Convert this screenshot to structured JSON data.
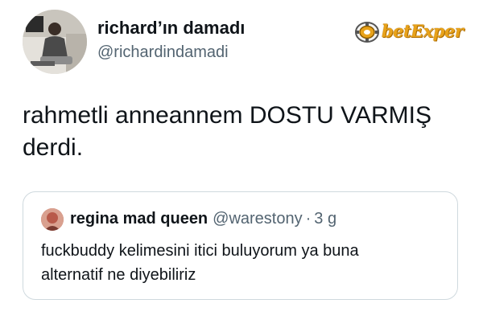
{
  "author": {
    "display_name": "richard’ın damadı",
    "handle": "@richardindamadi"
  },
  "tweet": {
    "text_line_1": "rahmetli anneannem DOSTU VARMIŞ",
    "text_line_2": "derdi."
  },
  "quoted_tweet": {
    "display_name": "regina mad queen",
    "handle": "@warestony",
    "separator": "·",
    "time": "3 g",
    "text_line_1": "fuckbuddy kelimesini itici buluyorum ya buna",
    "text_line_2": "alternatif ne diyebiliriz"
  },
  "watermark": {
    "brand_text": "betExper"
  },
  "colors": {
    "text_primary": "#0f1419",
    "text_secondary": "#536471",
    "border": "#cfd9de",
    "brand": "#e8a21a"
  },
  "icons": {
    "watermark_logo": "chip-coin-icon"
  }
}
